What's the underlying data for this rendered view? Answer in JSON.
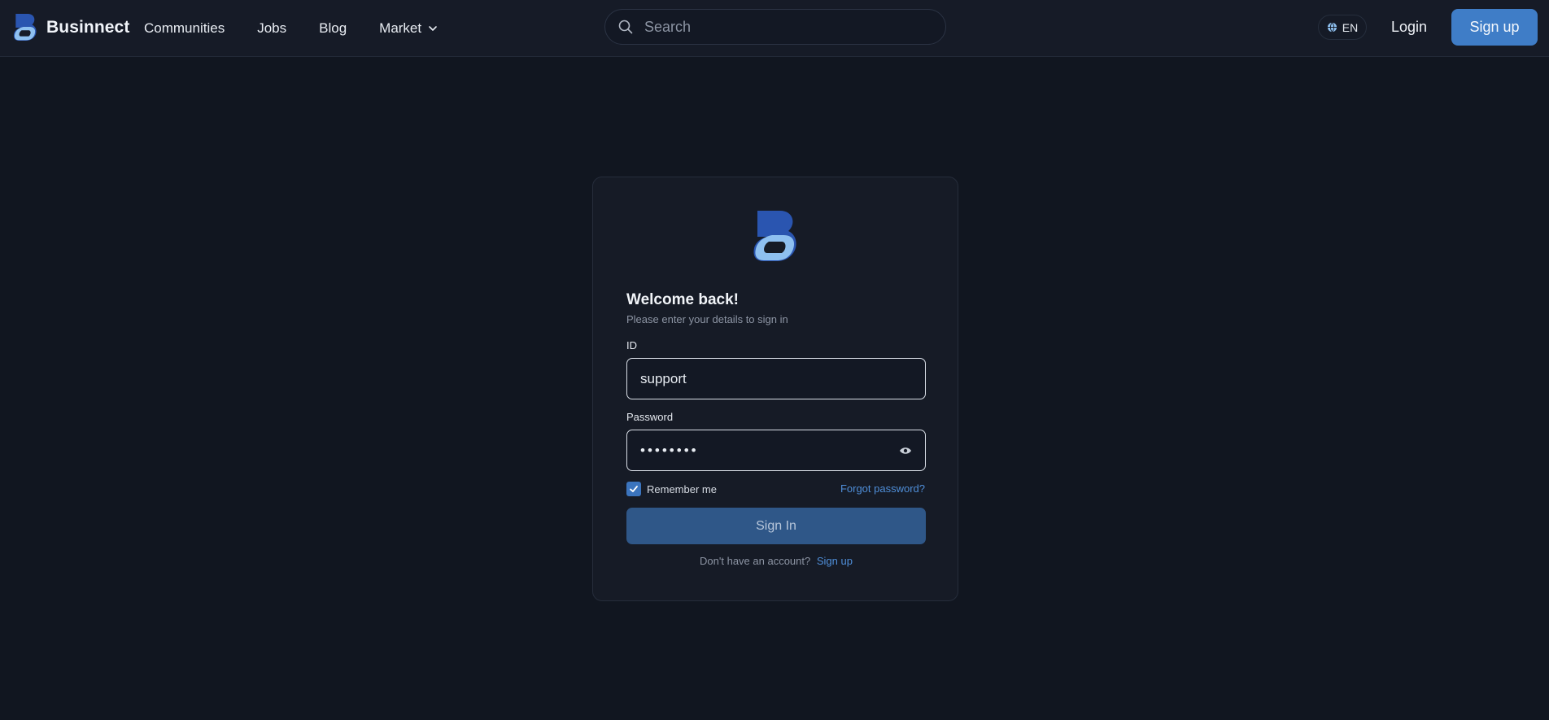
{
  "brand": {
    "name": "Businnect"
  },
  "nav": {
    "links": [
      {
        "label": "Communities"
      },
      {
        "label": "Jobs"
      },
      {
        "label": "Blog"
      },
      {
        "label": "Market"
      }
    ]
  },
  "search": {
    "placeholder": "Search",
    "value": ""
  },
  "header": {
    "language": "EN",
    "login_label": "Login",
    "signup_label": "Sign up"
  },
  "login_card": {
    "title": "Welcome back!",
    "subtitle": "Please enter your details to sign in",
    "id_label": "ID",
    "id_value": "support",
    "password_label": "Password",
    "password_value": "support1",
    "remember_label": "Remember me",
    "remember_checked": true,
    "forgot_label": "Forgot password?",
    "signin_label": "Sign In",
    "no_account_text": "Don't have an account?",
    "signup_link": "Sign up"
  },
  "icons": {
    "logo": "businnect-logo-icon",
    "search": "search-icon",
    "globe": "globe-icon",
    "chevron": "chevron-down-icon",
    "eye": "eye-icon",
    "check": "check-icon"
  },
  "colors": {
    "background": "#111620",
    "header": "#161b27",
    "accent": "#3f7dc7",
    "link": "#4f8ed8",
    "signin_button": "#2f5788",
    "logo_dark": "#2a55b0",
    "logo_light": "#8ec0f0"
  }
}
